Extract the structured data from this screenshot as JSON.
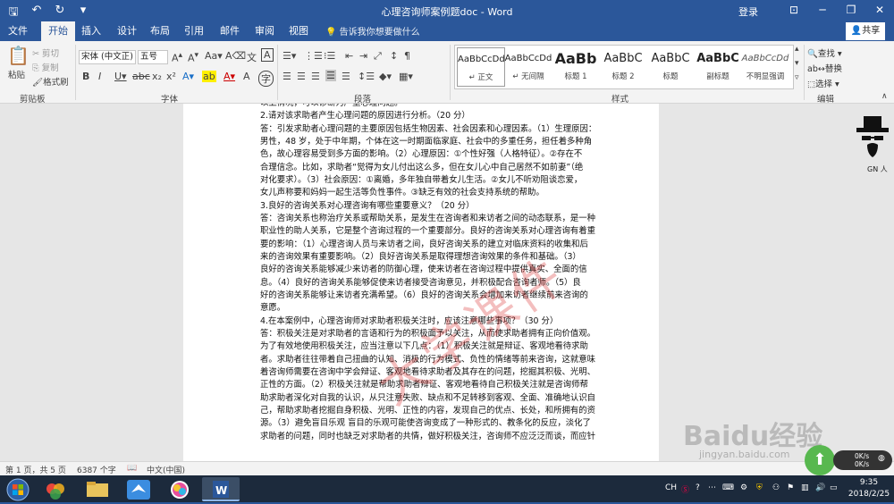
{
  "window": {
    "title": "心理咨询师案例题doc - Word",
    "login": "登录"
  },
  "tabs": [
    {
      "label": "文件",
      "active": false
    },
    {
      "label": "开始",
      "active": true
    },
    {
      "label": "插入",
      "active": false
    },
    {
      "label": "设计",
      "active": false
    },
    {
      "label": "布局",
      "active": false
    },
    {
      "label": "引用",
      "active": false
    },
    {
      "label": "邮件",
      "active": false
    },
    {
      "label": "审阅",
      "active": false
    },
    {
      "label": "视图",
      "active": false
    }
  ],
  "tell_me": "告诉我你想要做什么",
  "share": "共享",
  "clipboard": {
    "paste": "粘贴",
    "cut": "剪切",
    "copy": "复制",
    "format_painter": "格式刷",
    "group": "剪贴板"
  },
  "font": {
    "name": "宋体 (中文正)",
    "size": "五号",
    "group": "字体"
  },
  "paragraph": {
    "group": "段落"
  },
  "styles": {
    "group": "样式",
    "items": [
      {
        "preview": "AaBbCcDd",
        "name": "↵ 正文"
      },
      {
        "preview": "AaBbCcDd",
        "name": "↵ 无间隔"
      },
      {
        "preview": "AaBb",
        "name": "标题 1"
      },
      {
        "preview": "AaBbC",
        "name": "标题 2"
      },
      {
        "preview": "AaBbC",
        "name": "标题"
      },
      {
        "preview": "AaBbC",
        "name": "副标题"
      },
      {
        "preview": "AaBbCcDd",
        "name": "不明显强调"
      }
    ]
  },
  "editing": {
    "find": "查找",
    "replace": "替换",
    "select": "选择",
    "group": "编辑"
  },
  "document": {
    "lines": [
      "以上情况，可以诊断为严重心理问题。",
      "2.请对该求助者产生心理问题的原因进行分析。（20 分）",
      "答：引发求助者心理问题的主要原因包括生物因素、社会因素和心理因素。（1）生理原因：",
      "男性，48 岁，处于中年期，个体在这一时期面临家庭、社会中的多重任务，担任着多种角",
      "色，故心理容易受到多方面的影响。（2）心理原因：①个性好强（人格特征）。②存在不",
      "合理信念。比如，求助者“觉得为女儿付出这么多，但在女儿心中自己居然不如前妻”（绝",
      "对化要求）。（3）社会原因：①离婚，多年独自带着女儿生活。②女儿不听劝阻谈恋爱，",
      "女儿声称要和妈妈一起生活等负性事件。③缺乏有效的社会支持系统的帮助。",
      "3.良好的咨询关系对心理咨询有哪些重要意义？（20 分）",
      "答：咨询关系也称治疗关系或帮助关系，是发生在咨询者和来访者之间的动态联系，是一种",
      "职业性的助人关系，它是整个咨询过程的一个重要部分。良好的咨询关系对心理咨询有着重",
      "要的影响：（1）心理咨询人员与来访者之间，良好咨询关系的建立对临床资料的收集和后",
      "来的咨询效果有重要影响。（2）良好咨询关系是取得理想咨询效果的条件和基础。（3）",
      "良好的咨询关系能够减少来访者的防御心理，使来访者在咨询过程中提供真实、全面的信",
      "息。（4）良好的咨询关系能够促使来访者接受咨询意见，并积极配合咨询者师。（5）良",
      "好的咨询关系能够让来访者充满希望。（6）良好的咨询关系会增加来访者继续前来咨询的",
      "意愿。",
      "4.在本案例中，心理咨询师对求助者积极关注时，应该注意哪些事项？（30 分）",
      "答：积极关注是对求助者的言语和行为的积极面予以关注，从而使求助者拥有正向价值观。",
      "为了有效地使用积极关注，应当注意以下几点：（1）积极关注就是辩证、客观地看待求助",
      "者。求助者往往带着自己扭曲的认知、消极的行为模式、负性的情绪等前来咨询，这就意味",
      "着咨询师需要在咨询中学会辩证、客观地看待求助者及其存在的问题，挖掘其积极、光明、",
      "正性的方面。（2）积极关注就是帮助求助者辩证、客观地看待自己积极关注就是咨询师帮",
      "助求助者深化对自我的认识，从只注意失败、缺点和不足转移到客观、全面、准确地认识自",
      "己，帮助求助者挖掘自身积极、光明、正性的内容，发现自己的优点、长处，和所拥有的资",
      "源。（3）避免盲目乐观 盲目的乐观可能使咨询变成了一种形式的、教条化的反应，淡化了",
      "求助者的问题，同时也缺乏对求助者的共情，做好积极关注，咨询师不应泛泛而谈，而应针"
    ],
    "watermark": "大学课件"
  },
  "status": {
    "page": "第 1 页，共 5 页",
    "words": "6387 个字",
    "lang": "中文(中国)"
  },
  "overlays": {
    "baidu": "Baidu经验",
    "baidu_url": "jingyan.baidu.com",
    "net_up": "0K/s",
    "net_down": "0K/s",
    "mascot": "GN 人"
  },
  "taskbar": {
    "ime": "CH",
    "time": "9:35",
    "date": "2018/2/25"
  }
}
